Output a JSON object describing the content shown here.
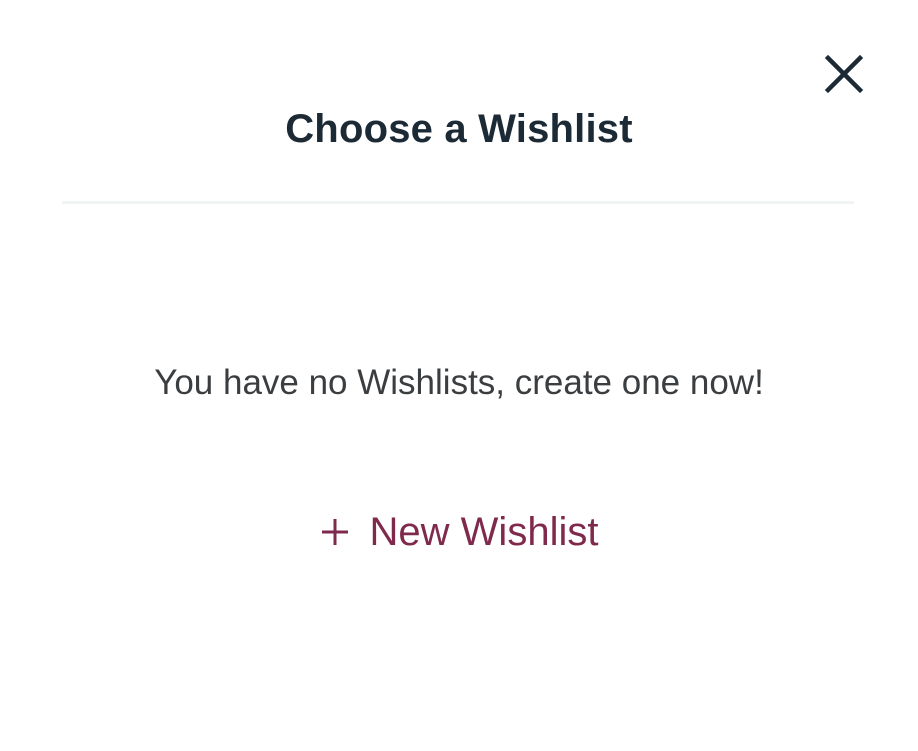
{
  "modal": {
    "title": "Choose a Wishlist",
    "close_icon": "close-icon",
    "empty_message": "You have no Wishlists, create one now!",
    "new_wishlist": {
      "icon": "plus-icon",
      "label": "New Wishlist"
    }
  },
  "colors": {
    "title": "#1c2a35",
    "text": "#3b3e40",
    "accent": "#7f2a4c",
    "divider": "#f1f4f4"
  }
}
